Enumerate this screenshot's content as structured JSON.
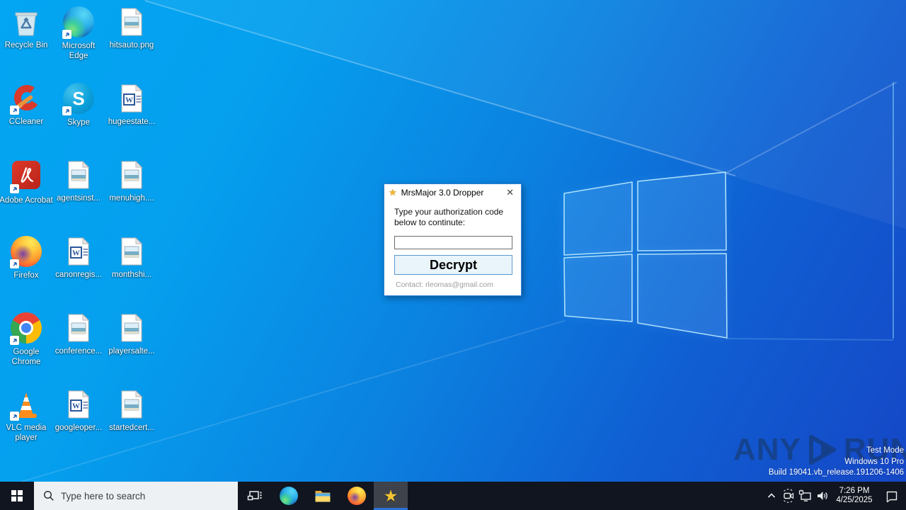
{
  "colors": {
    "wallpaper_top_left": "#03a6f2",
    "wallpaper_bottom_right": "#1547c6",
    "taskbar": "#10151f",
    "accent_blue": "#0078d7",
    "active_underline": "#2e6fd8",
    "star_gold": "#f5c432",
    "dialog_border": "#2f7fd6",
    "decrypt_button_bg": "#e9f4fb"
  },
  "desktop": {
    "items": [
      {
        "label": "Recycle Bin",
        "icon": "recycle-bin-icon",
        "shortcut": false
      },
      {
        "label": "Microsoft Edge",
        "icon": "edge-icon",
        "shortcut": true
      },
      {
        "label": "hitsauto.png",
        "icon": "image-file-icon",
        "shortcut": false
      },
      {
        "label": "CCleaner",
        "icon": "ccleaner-icon",
        "shortcut": true
      },
      {
        "label": "Skype",
        "icon": "skype-icon",
        "shortcut": true
      },
      {
        "label": "hugeestate...",
        "icon": "word-doc-icon",
        "shortcut": false
      },
      {
        "label": "Adobe Acrobat",
        "icon": "acrobat-icon",
        "shortcut": true
      },
      {
        "label": "agentsinst...",
        "icon": "image-file-icon",
        "shortcut": false
      },
      {
        "label": "menuhigh....",
        "icon": "image-file-icon",
        "shortcut": false
      },
      {
        "label": "Firefox",
        "icon": "firefox-icon",
        "shortcut": true
      },
      {
        "label": "canonregis...",
        "icon": "word-doc-icon",
        "shortcut": false
      },
      {
        "label": "monthshi...",
        "icon": "image-file-icon",
        "shortcut": false
      },
      {
        "label": "Google Chrome",
        "icon": "chrome-icon",
        "shortcut": true
      },
      {
        "label": "conference...",
        "icon": "image-file-icon",
        "shortcut": false
      },
      {
        "label": "playersalte...",
        "icon": "image-file-icon",
        "shortcut": false
      },
      {
        "label": "VLC media player",
        "icon": "vlc-icon",
        "shortcut": true
      },
      {
        "label": "googleoper...",
        "icon": "word-doc-icon",
        "shortcut": false
      },
      {
        "label": "startedcert...",
        "icon": "image-file-icon",
        "shortcut": false
      }
    ],
    "skype_letter": "S",
    "word_letter": "W"
  },
  "dialog": {
    "title": "MrsMajor 3.0 Dropper",
    "close": "✕",
    "title_star": "★",
    "message": "Type your authorization code below to continute:",
    "input_value": "",
    "button": "Decrypt",
    "contact": "Contact: rleomas@gmail.com"
  },
  "taskbar": {
    "search_placeholder": "Type here to search",
    "active_app_star": "★",
    "clock": {
      "time": "7:26 PM",
      "date": "4/25/2025"
    }
  },
  "watermark": {
    "logo_left": "ANY",
    "logo_right": "RUN",
    "line1": "Test Mode",
    "line2": "Windows 10 Pro",
    "line3": "Build 19041.vb_release.191206-1406"
  }
}
